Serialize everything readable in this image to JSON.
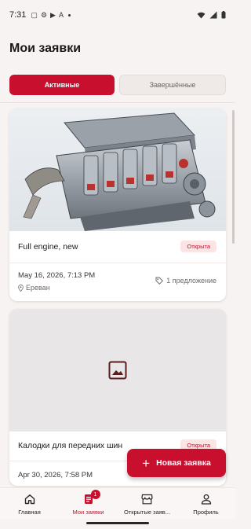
{
  "status_bar": {
    "time": "7:31",
    "icons": [
      "screenshot-icon",
      "settings-icon",
      "play-icon",
      "accessibility-icon",
      "dot-icon"
    ],
    "right_icons": [
      "wifi-icon",
      "signal-icon",
      "battery-icon"
    ]
  },
  "page": {
    "title": "Мои заявки"
  },
  "tabs": [
    {
      "label": "Активные",
      "active": true
    },
    {
      "label": "Завершённые",
      "active": false
    }
  ],
  "requests": [
    {
      "title": "Full engine, new",
      "status": "Открыта",
      "date": "May 16, 2026, 7:13 PM",
      "location": "Ереван",
      "offers": "1 предложение",
      "image": "engine-photo"
    },
    {
      "title": "Калодки для передних шин",
      "status": "Открыта",
      "date": "Apr 30, 2026, 7:58 PM",
      "image": "image-placeholder-icon"
    }
  ],
  "fab": {
    "label": "Новая заявка",
    "icon": "plus-icon"
  },
  "bottom_nav": [
    {
      "label": "Главная",
      "icon": "home-icon",
      "active": false
    },
    {
      "label": "Мои заявки",
      "icon": "requests-icon",
      "active": true,
      "badge": "1"
    },
    {
      "label": "Открытые заяв...",
      "icon": "store-icon",
      "active": false
    },
    {
      "label": "Профиль",
      "icon": "profile-icon",
      "active": false
    }
  ],
  "colors": {
    "accent": "#c8102e",
    "badge_bg": "#fde4e4",
    "background": "#f7f3f2"
  }
}
